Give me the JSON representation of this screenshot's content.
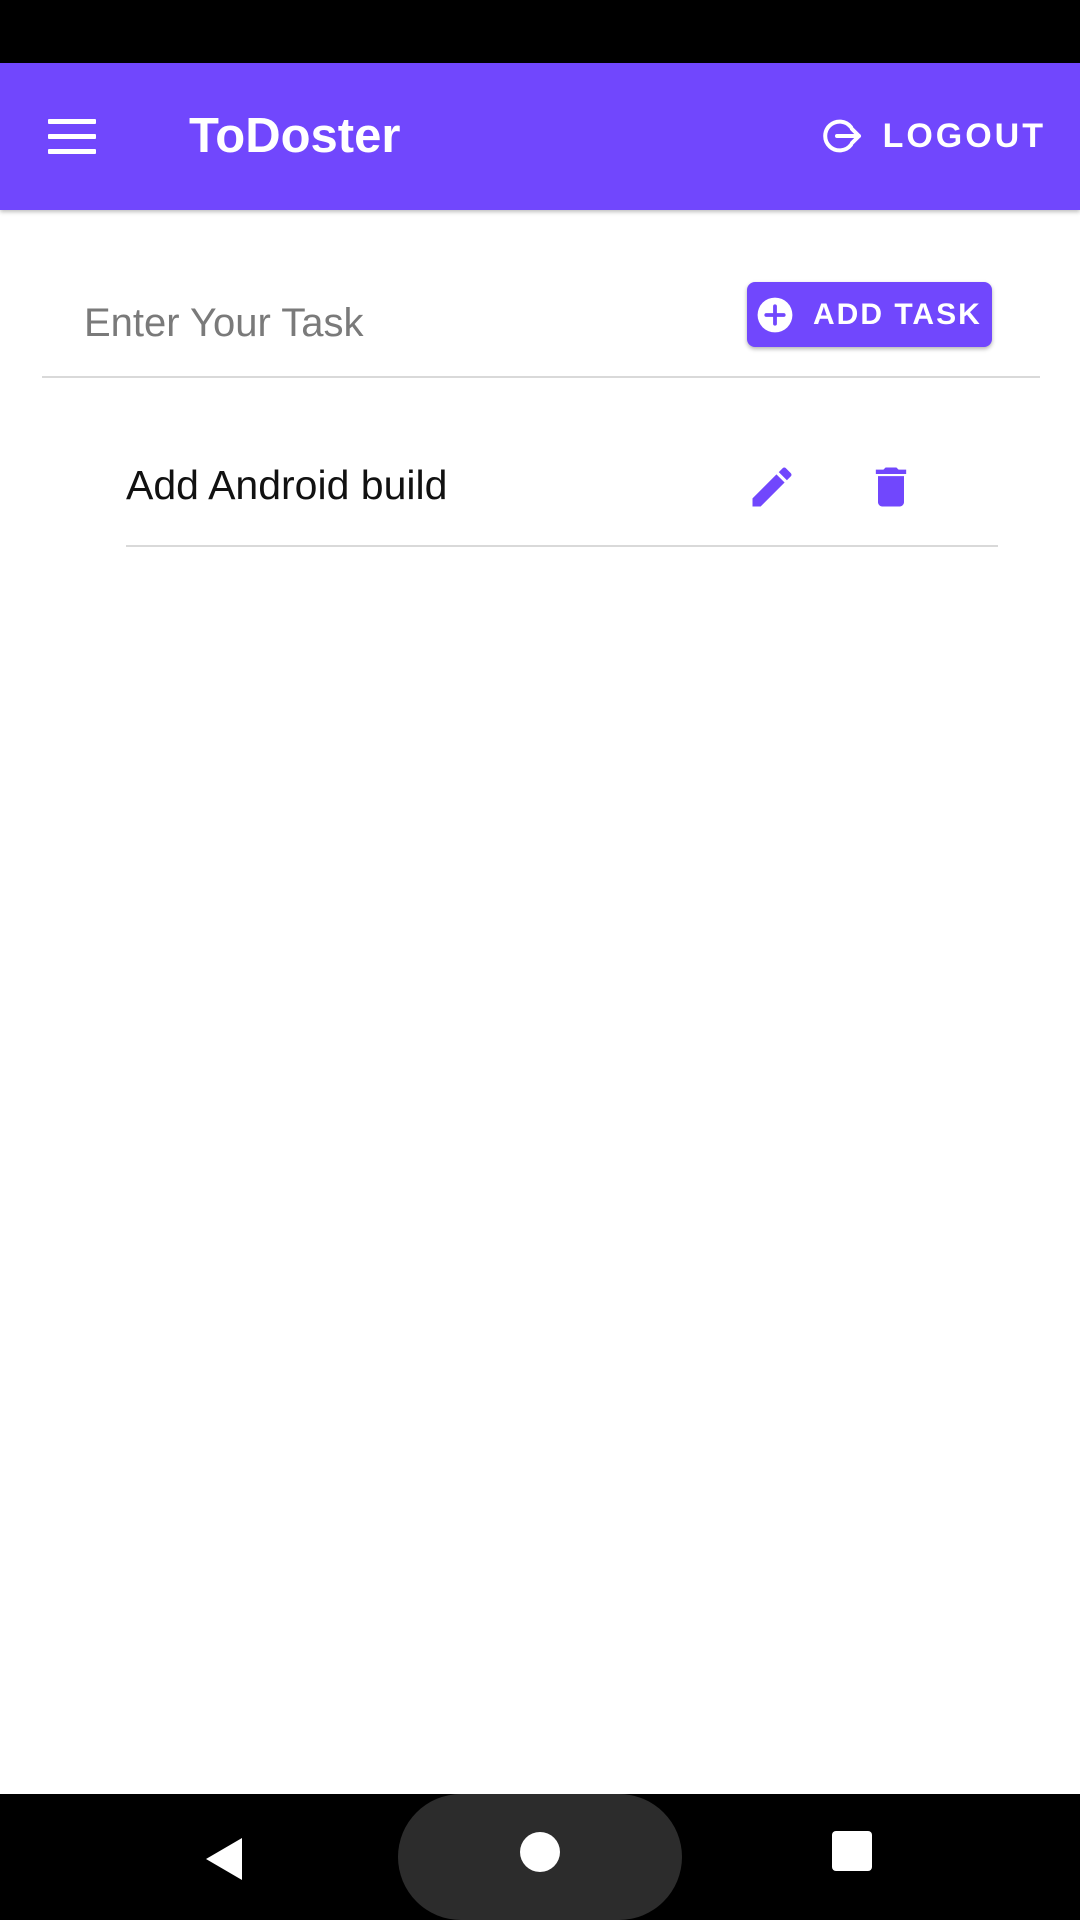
{
  "app": {
    "title": "ToDoster",
    "logout_label": "LOGOUT",
    "accent_color": "#7147fd"
  },
  "task_form": {
    "input_value": "",
    "input_placeholder": "Enter Your Task",
    "add_button_label": "ADD TASK"
  },
  "tasks": [
    {
      "text": "Add Android build"
    }
  ],
  "icons": {
    "menu": "hamburger-menu-icon",
    "logout": "logout-icon",
    "add": "add-circle-icon",
    "edit": "pencil-icon",
    "delete": "trash-icon",
    "nav_back": "triangle-back-icon",
    "nav_home": "circle-home-icon",
    "nav_recents": "square-recents-icon"
  }
}
